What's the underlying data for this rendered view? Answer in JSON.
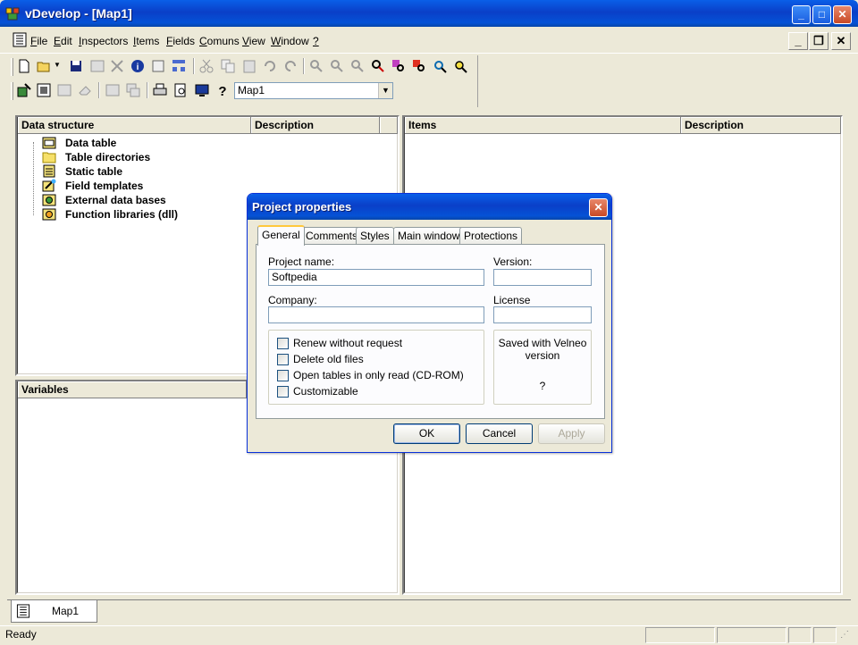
{
  "window": {
    "title": "vDevelop - [Map1]"
  },
  "caption_buttons": {
    "minimize": "_",
    "maximize": "□",
    "close": "✕"
  },
  "menu": {
    "items": [
      {
        "label": "File",
        "key": "F",
        "rest": "ile"
      },
      {
        "label": "Edit",
        "key": "E",
        "rest": "dit"
      },
      {
        "label": "Inspectors",
        "key": "I",
        "rest": "nspectors"
      },
      {
        "label": "Items",
        "key": "I",
        "rest": "tems"
      },
      {
        "label": "Fields",
        "key": "F",
        "rest": "ields"
      },
      {
        "label": "Comuns",
        "key": "C",
        "rest": "omuns"
      },
      {
        "label": "View",
        "key": "V",
        "rest": "iew"
      },
      {
        "label": "Window",
        "key": "W",
        "rest": "indow"
      },
      {
        "label": "?",
        "key": "?",
        "rest": ""
      }
    ],
    "mdi_buttons": {
      "minimize": "_",
      "restore": "❐",
      "close": "✕"
    }
  },
  "toolbar": {
    "map_selector": {
      "value": "Map1",
      "arrow": "▼"
    }
  },
  "left_panel": {
    "columns": [
      "Data structure",
      "Description"
    ],
    "tree": [
      {
        "label": "Data table",
        "icon": "data-table-icon"
      },
      {
        "label": "Table directories",
        "icon": "folder-icon"
      },
      {
        "label": "Static table",
        "icon": "static-table-icon"
      },
      {
        "label": "Field templates",
        "icon": "field-templates-icon"
      },
      {
        "label": "External data bases",
        "icon": "external-db-icon"
      },
      {
        "label": "Function libraries (dll)",
        "icon": "dll-icon"
      }
    ]
  },
  "variables_panel": {
    "title": "Variables"
  },
  "right_panel": {
    "columns": [
      "Items",
      "Description"
    ]
  },
  "doc_tab": {
    "label": "Map1"
  },
  "status": {
    "text": "Ready"
  },
  "dialog": {
    "title": "Project properties",
    "close": "✕",
    "tabs": [
      "General",
      "Comments",
      "Styles",
      "Main window",
      "Protections"
    ],
    "active_tab": "General",
    "fields": {
      "project_name": {
        "label": "Project name:",
        "value": "Softpedia"
      },
      "version": {
        "label": "Version:",
        "value": ""
      },
      "company": {
        "label": "Company:",
        "value": ""
      },
      "license": {
        "label": "License",
        "value": ""
      }
    },
    "checkboxes": [
      {
        "label": "Renew without request",
        "checked": false
      },
      {
        "label": "Delete old files",
        "checked": false
      },
      {
        "label": "Open tables in only read (CD-ROM)",
        "checked": false
      },
      {
        "label": "Customizable",
        "checked": false
      }
    ],
    "saved_with": {
      "label": "Saved with Velneo version",
      "value": "?"
    },
    "buttons": {
      "ok": "OK",
      "cancel": "Cancel",
      "apply": "Apply"
    }
  }
}
